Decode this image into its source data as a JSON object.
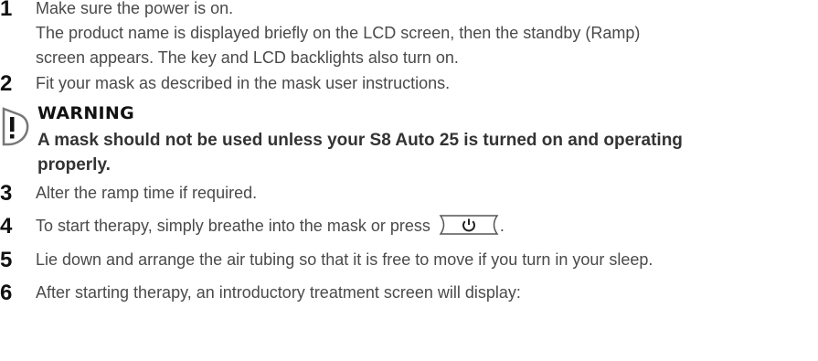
{
  "steps": [
    {
      "number": "1",
      "text": "Make sure the power is on.",
      "detail_lines": [
        "The product name is displayed briefly on the LCD screen, then the standby (Ramp)",
        "screen appears. The key and LCD backlights also turn on."
      ]
    },
    {
      "number": "2",
      "text": "Fit your mask as described in the mask user instructions."
    },
    {
      "number": "3",
      "text": "Alter the ramp time if required."
    },
    {
      "number": "4",
      "text": "To start therapy, simply breathe into the mask or press",
      "suffix": "."
    },
    {
      "number": "5",
      "text": "Lie down and arrange the air tubing so that it is free to move if you turn in your sleep."
    },
    {
      "number": "6",
      "text": "After starting therapy, an introductory treatment screen will display:"
    }
  ],
  "warning": {
    "title": "WARNING",
    "lines": [
      "A mask should not be used unless your S8 Auto 25 is turned on and operating",
      "properly."
    ],
    "icon": "warning-exclamation-icon"
  },
  "power_key": {
    "icon": "power-icon"
  }
}
